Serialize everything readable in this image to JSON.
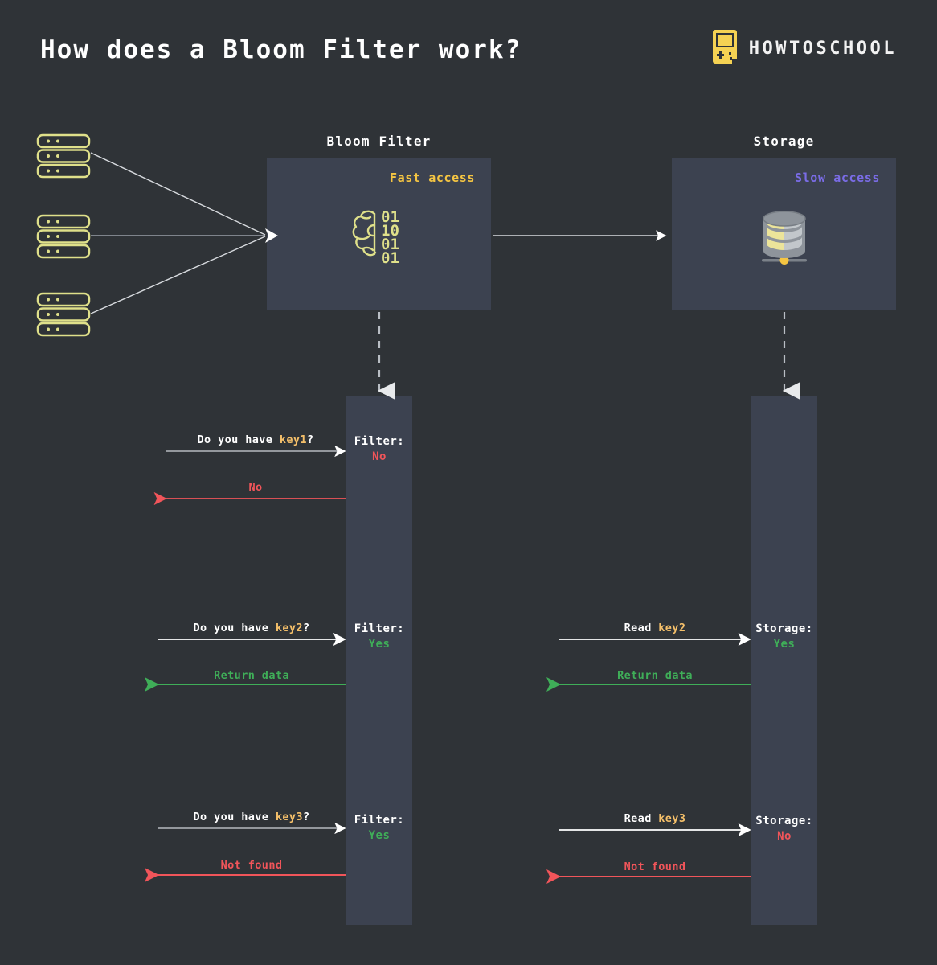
{
  "page": {
    "title": "How does a Bloom Filter work?",
    "background_color": "#2f3337",
    "panel_color": "#3c4250"
  },
  "brand": {
    "name": "HOWTOSCHOOL",
    "icon": "gameboy-icon",
    "icon_color": "#f5d253"
  },
  "colors": {
    "accent_yellow": "#f5c542",
    "key_yellow": "#f5c06a",
    "purple": "#7a6ce6",
    "green": "#3fae58",
    "red": "#f1555a",
    "white": "#ffffff",
    "icon_olive": "#dfe08a"
  },
  "sources": {
    "icon": "server-stack-icon",
    "count": 3,
    "items": [
      {
        "label": ""
      },
      {
        "label": ""
      },
      {
        "label": ""
      }
    ]
  },
  "participants": [
    {
      "id": "bloom",
      "title": "Bloom Filter",
      "access_label": "Fast access",
      "access_color": "#f5c542",
      "icon": "brain-binary-icon",
      "binary_rows": [
        "01",
        "10",
        "01",
        "01"
      ]
    },
    {
      "id": "storage",
      "title": "Storage",
      "access_label": "Slow access",
      "access_color": "#7a6ce6",
      "icon": "database-cylinder-icon",
      "binary_rows": []
    }
  ],
  "sequence": {
    "bloom_lifeline_states": [
      {
        "label": "Filter:",
        "verdict": "No",
        "verdict_color": "#f1555a"
      },
      {
        "label": "Filter:",
        "verdict": "Yes",
        "verdict_color": "#3fae58"
      },
      {
        "label": "Filter:",
        "verdict": "Yes",
        "verdict_color": "#3fae58"
      }
    ],
    "storage_lifeline_states": [
      {
        "label": "Storage:",
        "verdict": "Yes",
        "verdict_color": "#3fae58"
      },
      {
        "label": "Storage:",
        "verdict": "No",
        "verdict_color": "#f1555a"
      }
    ],
    "messages": [
      {
        "id": "req-key1",
        "prefix": "Do you have ",
        "key": "key1",
        "suffix": "?",
        "direction": "right",
        "color": "#ffffff"
      },
      {
        "id": "resp-key1",
        "prefix": "No",
        "key": "",
        "suffix": "",
        "direction": "left",
        "color": "#f1555a"
      },
      {
        "id": "req-key2",
        "prefix": "Do you have ",
        "key": "key2",
        "suffix": "?",
        "direction": "right",
        "color": "#ffffff"
      },
      {
        "id": "resp-key2",
        "prefix": "Return data",
        "key": "",
        "suffix": "",
        "direction": "left",
        "color": "#3fae58"
      },
      {
        "id": "req-key3",
        "prefix": "Do you have ",
        "key": "key3",
        "suffix": "?",
        "direction": "right",
        "color": "#ffffff"
      },
      {
        "id": "resp-key3",
        "prefix": "Not found",
        "key": "",
        "suffix": "",
        "direction": "left",
        "color": "#f1555a"
      },
      {
        "id": "read-key2",
        "prefix": "Read ",
        "key": "key2",
        "suffix": "",
        "direction": "right",
        "color": "#ffffff"
      },
      {
        "id": "return-key2",
        "prefix": "Return data",
        "key": "",
        "suffix": "",
        "direction": "left",
        "color": "#3fae58"
      },
      {
        "id": "read-key3",
        "prefix": "Read ",
        "key": "key3",
        "suffix": "",
        "direction": "right",
        "color": "#ffffff"
      },
      {
        "id": "notfound-key3",
        "prefix": "Not found",
        "key": "",
        "suffix": "",
        "direction": "left",
        "color": "#f1555a"
      }
    ]
  },
  "labels": {
    "req_key1_pre": "Do you have ",
    "req_key1_key": "key1",
    "req_key1_post": "?",
    "resp_key1": "No",
    "req_key2_pre": "Do you have ",
    "req_key2_key": "key2",
    "req_key2_post": "?",
    "resp_key2": "Return data",
    "req_key3_pre": "Do you have ",
    "req_key3_key": "key3",
    "req_key3_post": "?",
    "resp_key3": "Not found",
    "read_key2_pre": "Read ",
    "read_key2_key": "key2",
    "return_key2": "Return data",
    "read_key3_pre": "Read ",
    "read_key3_key": "key3",
    "notfound_key3": "Not found",
    "filter": "Filter:",
    "storage": "Storage:",
    "yes": "Yes",
    "no": "No"
  }
}
